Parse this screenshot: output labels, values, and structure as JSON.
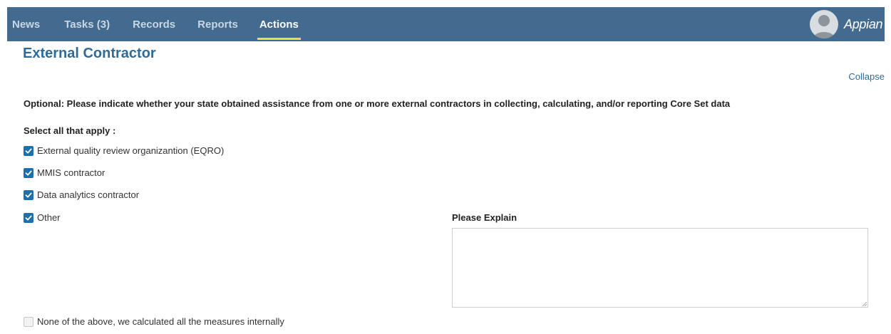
{
  "nav": {
    "tabs": [
      {
        "label": "News",
        "active": false
      },
      {
        "label": "Tasks (3)",
        "active": false
      },
      {
        "label": "Records",
        "active": false
      },
      {
        "label": "Reports",
        "active": false
      },
      {
        "label": "Actions",
        "active": true
      }
    ],
    "brand": "Appian",
    "avatar_icon": "user-avatar-icon"
  },
  "section": {
    "title": "External Contractor",
    "collapse_label": "Collapse",
    "question": "Optional: Please indicate whether your state obtained assistance from one or more external contractors in collecting, calculating, and/or reporting Core Set data",
    "select_label": "Select all that apply :",
    "options": [
      {
        "label": "External quality review organizantion (EQRO)",
        "checked": true
      },
      {
        "label": "MMIS contractor",
        "checked": true
      },
      {
        "label": "Data analytics contractor",
        "checked": true
      },
      {
        "label": "Other",
        "checked": true
      }
    ],
    "explain_label": "Please Explain",
    "explain_value": "",
    "none_option": {
      "label": "None of the above, we calculated all the measures internally",
      "checked": false
    }
  },
  "colors": {
    "header_bg": "#436a8f",
    "active_underline": "#f4d84a",
    "title_color": "#2e6b99",
    "checkbox_checked": "#1e6fae"
  }
}
